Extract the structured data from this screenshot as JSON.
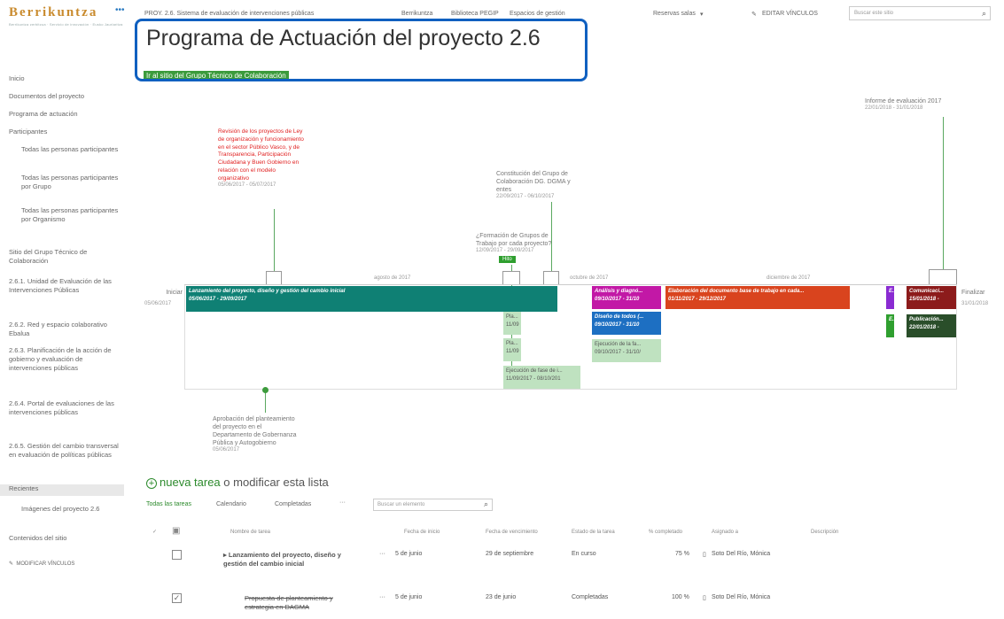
{
  "brand": {
    "logo_text": "Berrikuntza",
    "logo_subtitle": "Berrikuntza zerbitzua · Servicio de innovación · Eusko Jaurlaritza"
  },
  "top_nav": {
    "items": [
      "PROY. 2.6. Sistema de evaluación de intervenciones públicas",
      "Berrikuntza",
      "Biblioteca PEGIP",
      "Espacios de gestión",
      "Reservas salas"
    ],
    "edit_links": "EDITAR VÍNCULOS",
    "search_placeholder": "Buscar este sitio"
  },
  "page": {
    "title": "Programa de Actuación del proyecto 2.6",
    "group_link": "Ir al sitio del Grupo Técnico de Colaboración"
  },
  "left_nav": {
    "items": [
      "Inicio",
      "Documentos del proyecto",
      "Programa de actuación",
      "Participantes"
    ],
    "participants_sub": [
      "Todas las personas participantes",
      "Todas las personas participantes por Grupo",
      "Todas las personas participantes por Organismo"
    ],
    "items2": [
      "Sitio del Grupo Técnico de Colaboración",
      "2.6.1. Unidad de Evaluación de las Intervenciones Públicas",
      "2.6.2. Red y espacio colaborativo Ebalua",
      "2.6.3. Planificación de la acción de gobierno y evaluación de intervenciones públicas",
      "2.6.4. Portal de evaluaciones de las intervenciones públicas",
      "2.6.5. Gestión del cambio transversal en evaluación de políticas públicas"
    ],
    "recientes": "Recientes",
    "recientes_sub": "Imágenes del proyecto 2.6",
    "site_contents": "Contenidos del sitio",
    "edit_links": "MODIFICAR VÍNCULOS"
  },
  "timeline": {
    "start_label": "Iniciar",
    "start_date": "05/06/2017",
    "end_label": "Finalizar",
    "end_date": "31/01/2018",
    "months": [
      "agosto de 2017",
      "octubre de 2017",
      "diciembre de 2017"
    ],
    "callout_red": "Revisión de los proyectos de Ley de organización y funcionamiento en el sector Público Vasco, y de Transparencia, Participación Ciudadana y Buen Gobierno en relación con el modelo organizativo",
    "callout_red_date": "05/06/2017 - 05/07/2017",
    "callout_constitucion": "Constitución del Grupo de Colaboración DG. DGMA y entes",
    "callout_constitucion_date": "22/09/2017 - 06/10/2017",
    "callout_formacion": "¿Formación de Grupos de Trabajo por cada proyecto?",
    "callout_formacion_date": "12/09/2017 - 29/09/2017",
    "callout_informe": "Informe de evaluación 2017",
    "callout_informe_date": "22/01/2018 - 31/01/2018",
    "callout_aprobacion": "Aprobación del planteamiento del proyecto en el Departamento de Gobernanza Pública y Autogobierno",
    "callout_aprobacion_date": "05/06/2017",
    "hito": "Hito",
    "bar_main_title": "Lanzamiento del proyecto, diseño y gestión del cambio inicial",
    "bar_main_date": "05/06/2017 - 29/09/2017",
    "bar_analisis": "Análisis y diagnó...",
    "bar_analisis_date": "09/10/2017 - 31/10",
    "bar_diseno": "Diseño de todos (...",
    "bar_diseno_date": "09/10/2017 - 31/10",
    "bar_ejecucion_a": "Ejecución de la fa...",
    "bar_ejecucion_a_date": "09/10/2017 - 31/10/",
    "bar_elaboracion": "Elaboración del documento base de trabajo en cada...",
    "bar_elaboracion_date": "01/11/2017 - 29/12/2017",
    "bar_pla1": "Pla...",
    "bar_pla1_date": "11/09",
    "bar_pla2": "Pla...",
    "bar_pla2_date": "11/09",
    "bar_ejecucion_b": "Ejecución de fase de i...",
    "bar_ejecucion_b_date": "11/09/2017 - 08/10/201",
    "bar_e1": "E...",
    "bar_e2": "E...",
    "bar_comunicaci": "Comunicaci...",
    "bar_comunicaci_date": "15/01/2018 -",
    "bar_publicacion": "Publicación...",
    "bar_publicacion_date": "22/01/2018 -",
    "colors": {
      "teal": "#0f8074",
      "magenta": "#c218a6",
      "blue": "#1d6fc2",
      "light_green": "#bfe2c0",
      "orange": "#d9441e",
      "purple": "#8a2bd2",
      "green": "#2f9f2f",
      "maroon": "#8c1b1b",
      "dark_green": "#2a4e2a"
    }
  },
  "tasks": {
    "new_task_green": "nueva tarea",
    "new_task_rest": "o modificar esta lista",
    "views": [
      "Todas las tareas",
      "Calendario",
      "Completadas",
      "···"
    ],
    "find_placeholder": "Buscar un elemento",
    "headers": [
      "Nombre de tarea",
      "Fecha de inicio",
      "Fecha de vencimiento",
      "Estado de la tarea",
      "% completado",
      "Asignado a",
      "Descripción"
    ],
    "rows": [
      {
        "name": "Lanzamiento del proyecto, diseño y gestión del cambio inicial",
        "start": "5 de junio",
        "due": "29 de septiembre",
        "status": "En curso",
        "pct": "75 %",
        "assigned": "Soto Del Río, Mónica",
        "checked": false
      },
      {
        "name": "Propuesta de planteamiento y estrategia en DAGMA",
        "start": "5 de junio",
        "due": "23 de junio",
        "status": "Completadas",
        "pct": "100 %",
        "assigned": "Soto Del Río, Mónica",
        "checked": true
      }
    ]
  }
}
